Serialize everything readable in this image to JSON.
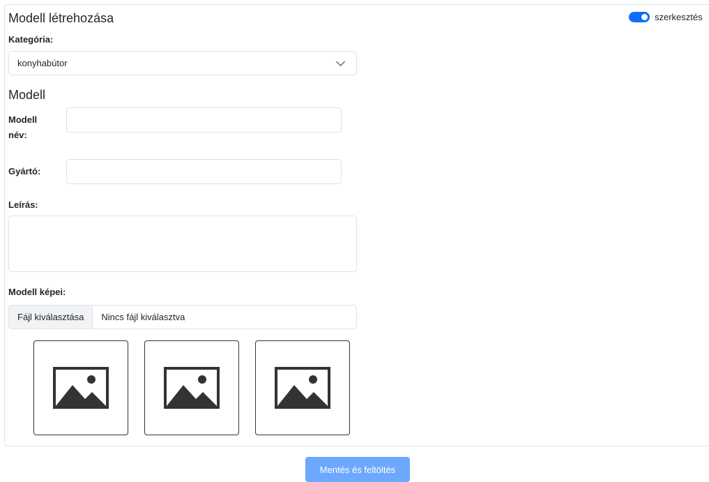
{
  "header": {
    "title": "Modell létrehozása",
    "toggle_label": "szerkesztés",
    "toggle_on": true,
    "accent": "#0d6efd"
  },
  "category": {
    "label": "Kategória:",
    "value": "konyhabútor"
  },
  "model": {
    "heading": "Modell",
    "name_label_line1": "Modell",
    "name_label_line2": "név:",
    "name_value": "",
    "manufacturer_label": "Gyártó:",
    "manufacturer_value": "",
    "description_label": "Leírás:",
    "description_value": ""
  },
  "images": {
    "label": "Modell képei:",
    "file_button": "Fájl kiválasztása",
    "file_status": "Nincs fájl kiválasztva",
    "placeholders": [
      "image-icon",
      "image-icon",
      "image-icon"
    ]
  },
  "footer": {
    "save_label": "Mentés és feltöltés",
    "save_color": "#6ea8fe"
  }
}
